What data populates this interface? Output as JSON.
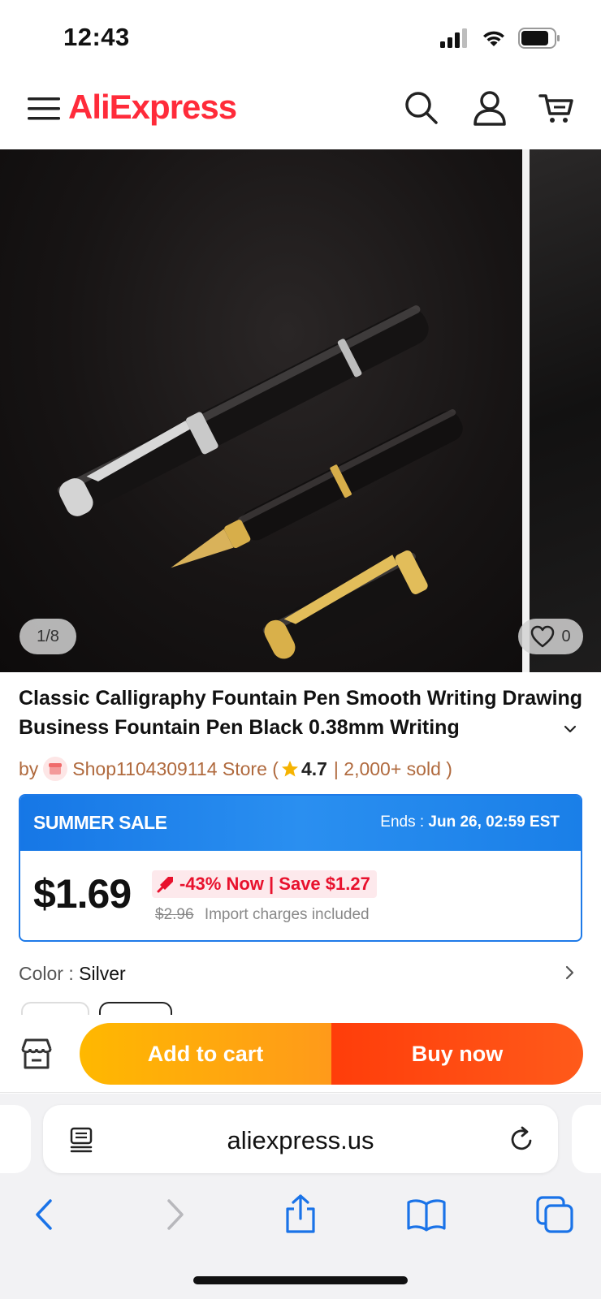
{
  "status_bar": {
    "time": "12:43"
  },
  "header": {
    "logo_text": "AliExpress",
    "icons": [
      "menu-icon",
      "search-icon",
      "account-icon",
      "cart-icon"
    ]
  },
  "gallery": {
    "counter": "1/8",
    "wishlist_count": "0"
  },
  "product": {
    "title": "Classic Calligraphy Fountain Pen Smooth Writing Drawing Business Fountain Pen Black 0.38mm Writing",
    "store_prefix": "by",
    "store_name": "Shop1104309114 Store (",
    "rating": "4.7",
    "sold": "| 2,000+ sold )"
  },
  "sale": {
    "title": "SUMMER SALE",
    "ends_label": "Ends :",
    "ends_value": "Jun 26, 02:59 EST",
    "price": "$1.69",
    "discount": "-43% Now | Save $1.27",
    "original_price": "$2.96",
    "import_note": "Import charges included"
  },
  "color": {
    "label": "Color :",
    "value": "Silver"
  },
  "actions": {
    "add_to_cart": "Add to cart",
    "buy_now": "Buy now"
  },
  "browser": {
    "url": "aliexpress.us"
  },
  "colors": {
    "brand_red": "#ff2b3a",
    "sale_blue": "#1e7ae8",
    "cart_yellow": "#ffb800",
    "buy_orange": "#ff3d0a",
    "discount_red": "#e8112d"
  }
}
